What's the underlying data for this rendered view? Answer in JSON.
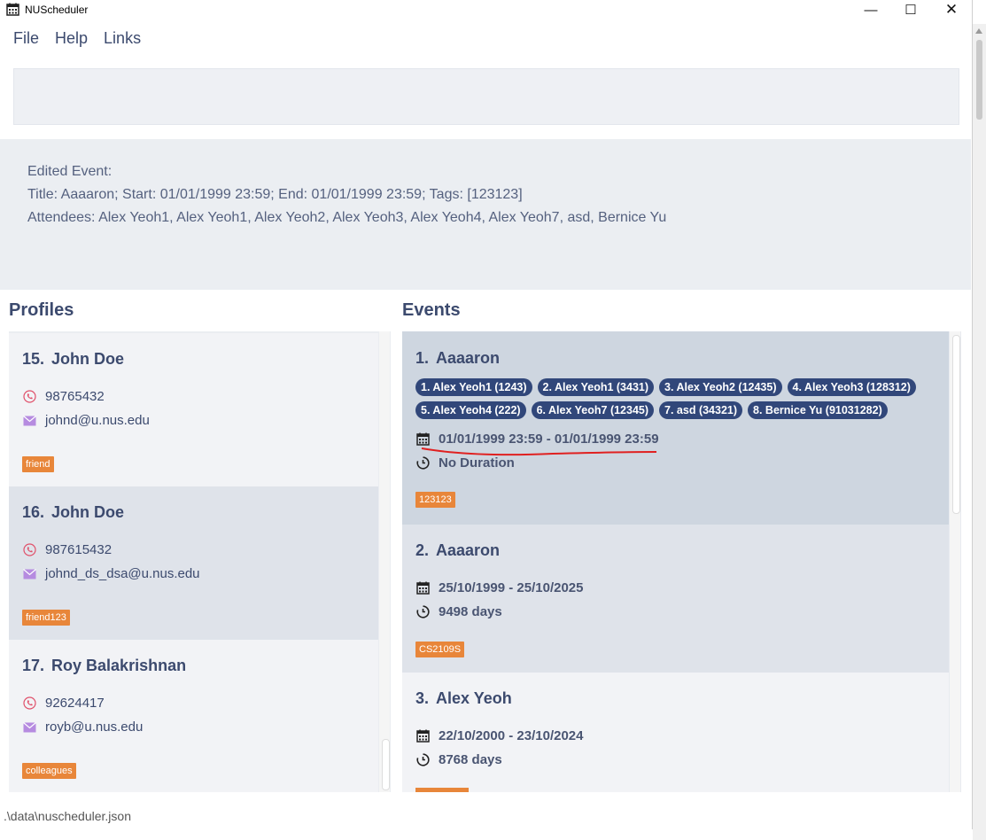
{
  "window": {
    "title": "NUScheduler",
    "min_symbol": "—",
    "max_symbol": "☐",
    "close_symbol": "✕"
  },
  "menu": [
    "File",
    "Help",
    "Links"
  ],
  "command_box": {
    "value": ""
  },
  "result": {
    "lines": [
      "Edited Event:",
      "Title: Aaaaron; Start: 01/01/1999 23:59; End: 01/01/1999 23:59; Tags: [123123]",
      "Attendees: Alex Yeoh1, Alex Yeoh1, Alex Yeoh2, Alex Yeoh3, Alex Yeoh4, Alex Yeoh7, asd, Bernice Yu"
    ]
  },
  "profiles": {
    "title": "Profiles",
    "items": [
      {
        "index": "15.",
        "name": "John Doe",
        "phone": "98765432",
        "email": "johnd@u.nus.edu",
        "tag": "friend"
      },
      {
        "index": "16.",
        "name": "John Doe",
        "phone": "987615432",
        "email": "johnd_ds_dsa@u.nus.edu",
        "tag": "friend123"
      },
      {
        "index": "17.",
        "name": "Roy Balakrishnan",
        "phone": "92624417",
        "email": "royb@u.nus.edu",
        "tag": "colleagues"
      }
    ]
  },
  "events": {
    "title": "Events",
    "items": [
      {
        "index": "1.",
        "name": "Aaaaron",
        "attendees": [
          "1. Alex Yeoh1 (1243)",
          "2. Alex Yeoh1 (3431)",
          "3. Alex Yeoh2 (12435)",
          "4. Alex Yeoh3 (128312)",
          "5. Alex Yeoh4 (222)",
          "6. Alex Yeoh7 (12345)",
          "7. asd (34321)",
          "8. Bernice Yu (91031282)"
        ],
        "range": "01/01/1999 23:59 - 01/01/1999 23:59",
        "duration": "No Duration",
        "tag": "123123"
      },
      {
        "index": "2.",
        "name": "Aaaaron",
        "attendees": [],
        "range": "25/10/1999 - 25/10/2025",
        "duration": "9498 days",
        "tag": "CS2109S"
      },
      {
        "index": "3.",
        "name": "Alex Yeoh",
        "attendees": [],
        "range": "22/10/2000 - 23/10/2024",
        "duration": "8768 days",
        "tag": ""
      }
    ]
  },
  "status": {
    "path": ".\\data\\nuscheduler.json"
  },
  "colors": {
    "accent": "#3c4a6e",
    "tag": "#e8863a",
    "chip": "#31477a",
    "annotation": "#e02020"
  },
  "icons": {
    "phone": "phone-icon",
    "email": "email-icon",
    "calendar": "calendar-icon",
    "clock": "clock-icon"
  }
}
